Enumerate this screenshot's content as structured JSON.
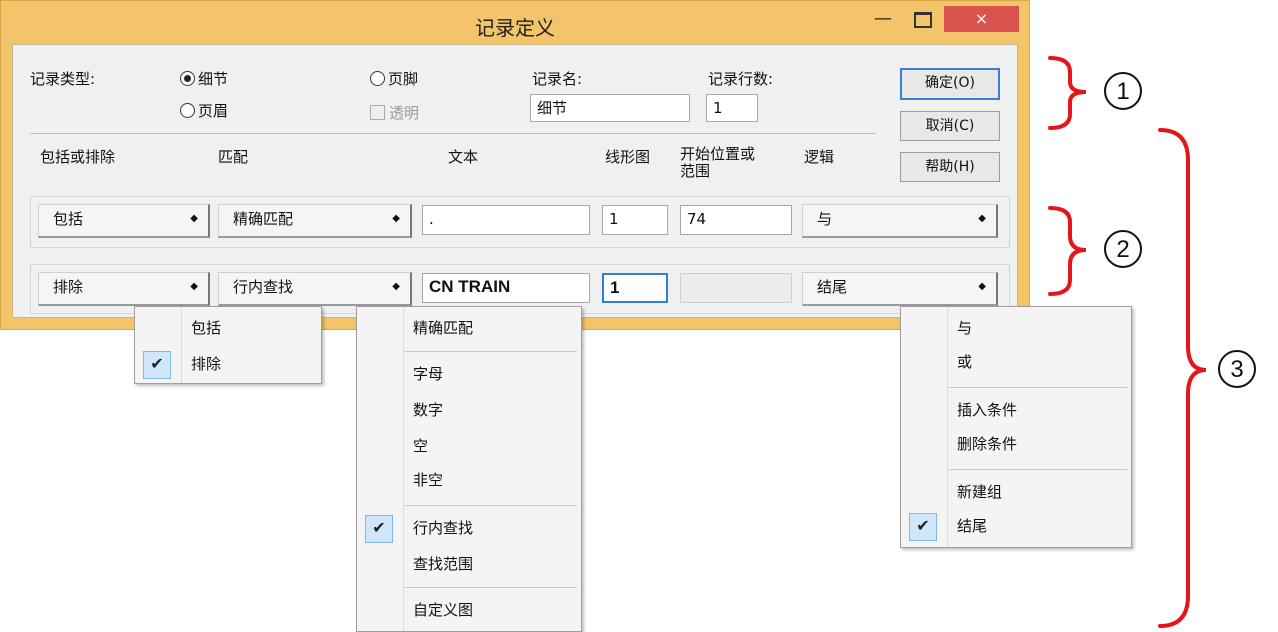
{
  "window": {
    "title": "记录定义",
    "minimize": "—",
    "close": "×"
  },
  "record_type": {
    "label": "记录类型:",
    "options": [
      "细节",
      "页眉",
      "页脚"
    ],
    "selected": "细节",
    "transparent_label": "透明"
  },
  "record_name": {
    "label": "记录名:",
    "value": "细节"
  },
  "record_lines": {
    "label": "记录行数:",
    "value": "1"
  },
  "buttons": {
    "ok": "确定(O)",
    "cancel": "取消(C)",
    "help": "帮助(H)"
  },
  "columns": {
    "include": "包括或排除",
    "match": "匹配",
    "text": "文本",
    "line": "线形图",
    "position": "开始位置或\n范围",
    "logic": "逻辑"
  },
  "rows": [
    {
      "include": "包括",
      "match": "精确匹配",
      "text": ".",
      "line": "1",
      "position": "74",
      "logic": "与"
    },
    {
      "include": "排除",
      "match": "行内查找",
      "text": "CN TRAIN",
      "line": "1",
      "position": "",
      "logic": "结尾"
    }
  ],
  "menus": {
    "include": {
      "items": [
        "包括",
        "排除"
      ],
      "checked": "排除"
    },
    "match": {
      "groups": [
        [
          "精确匹配"
        ],
        [
          "字母",
          "数字",
          "空",
          "非空"
        ],
        [
          "行内查找",
          "查找范围"
        ],
        [
          "自定义图"
        ]
      ],
      "checked": "行内查找"
    },
    "logic": {
      "groups": [
        [
          "与",
          "或"
        ],
        [
          "插入条件",
          "删除条件"
        ],
        [
          "新建组",
          "结尾"
        ]
      ],
      "checked": "结尾"
    }
  },
  "callouts": [
    "1",
    "2",
    "3"
  ],
  "colors": {
    "frame": "#f4c46b",
    "annotation": "#e4151b",
    "check_bg": "#cfe6fb",
    "close_button": "#d9534f"
  }
}
